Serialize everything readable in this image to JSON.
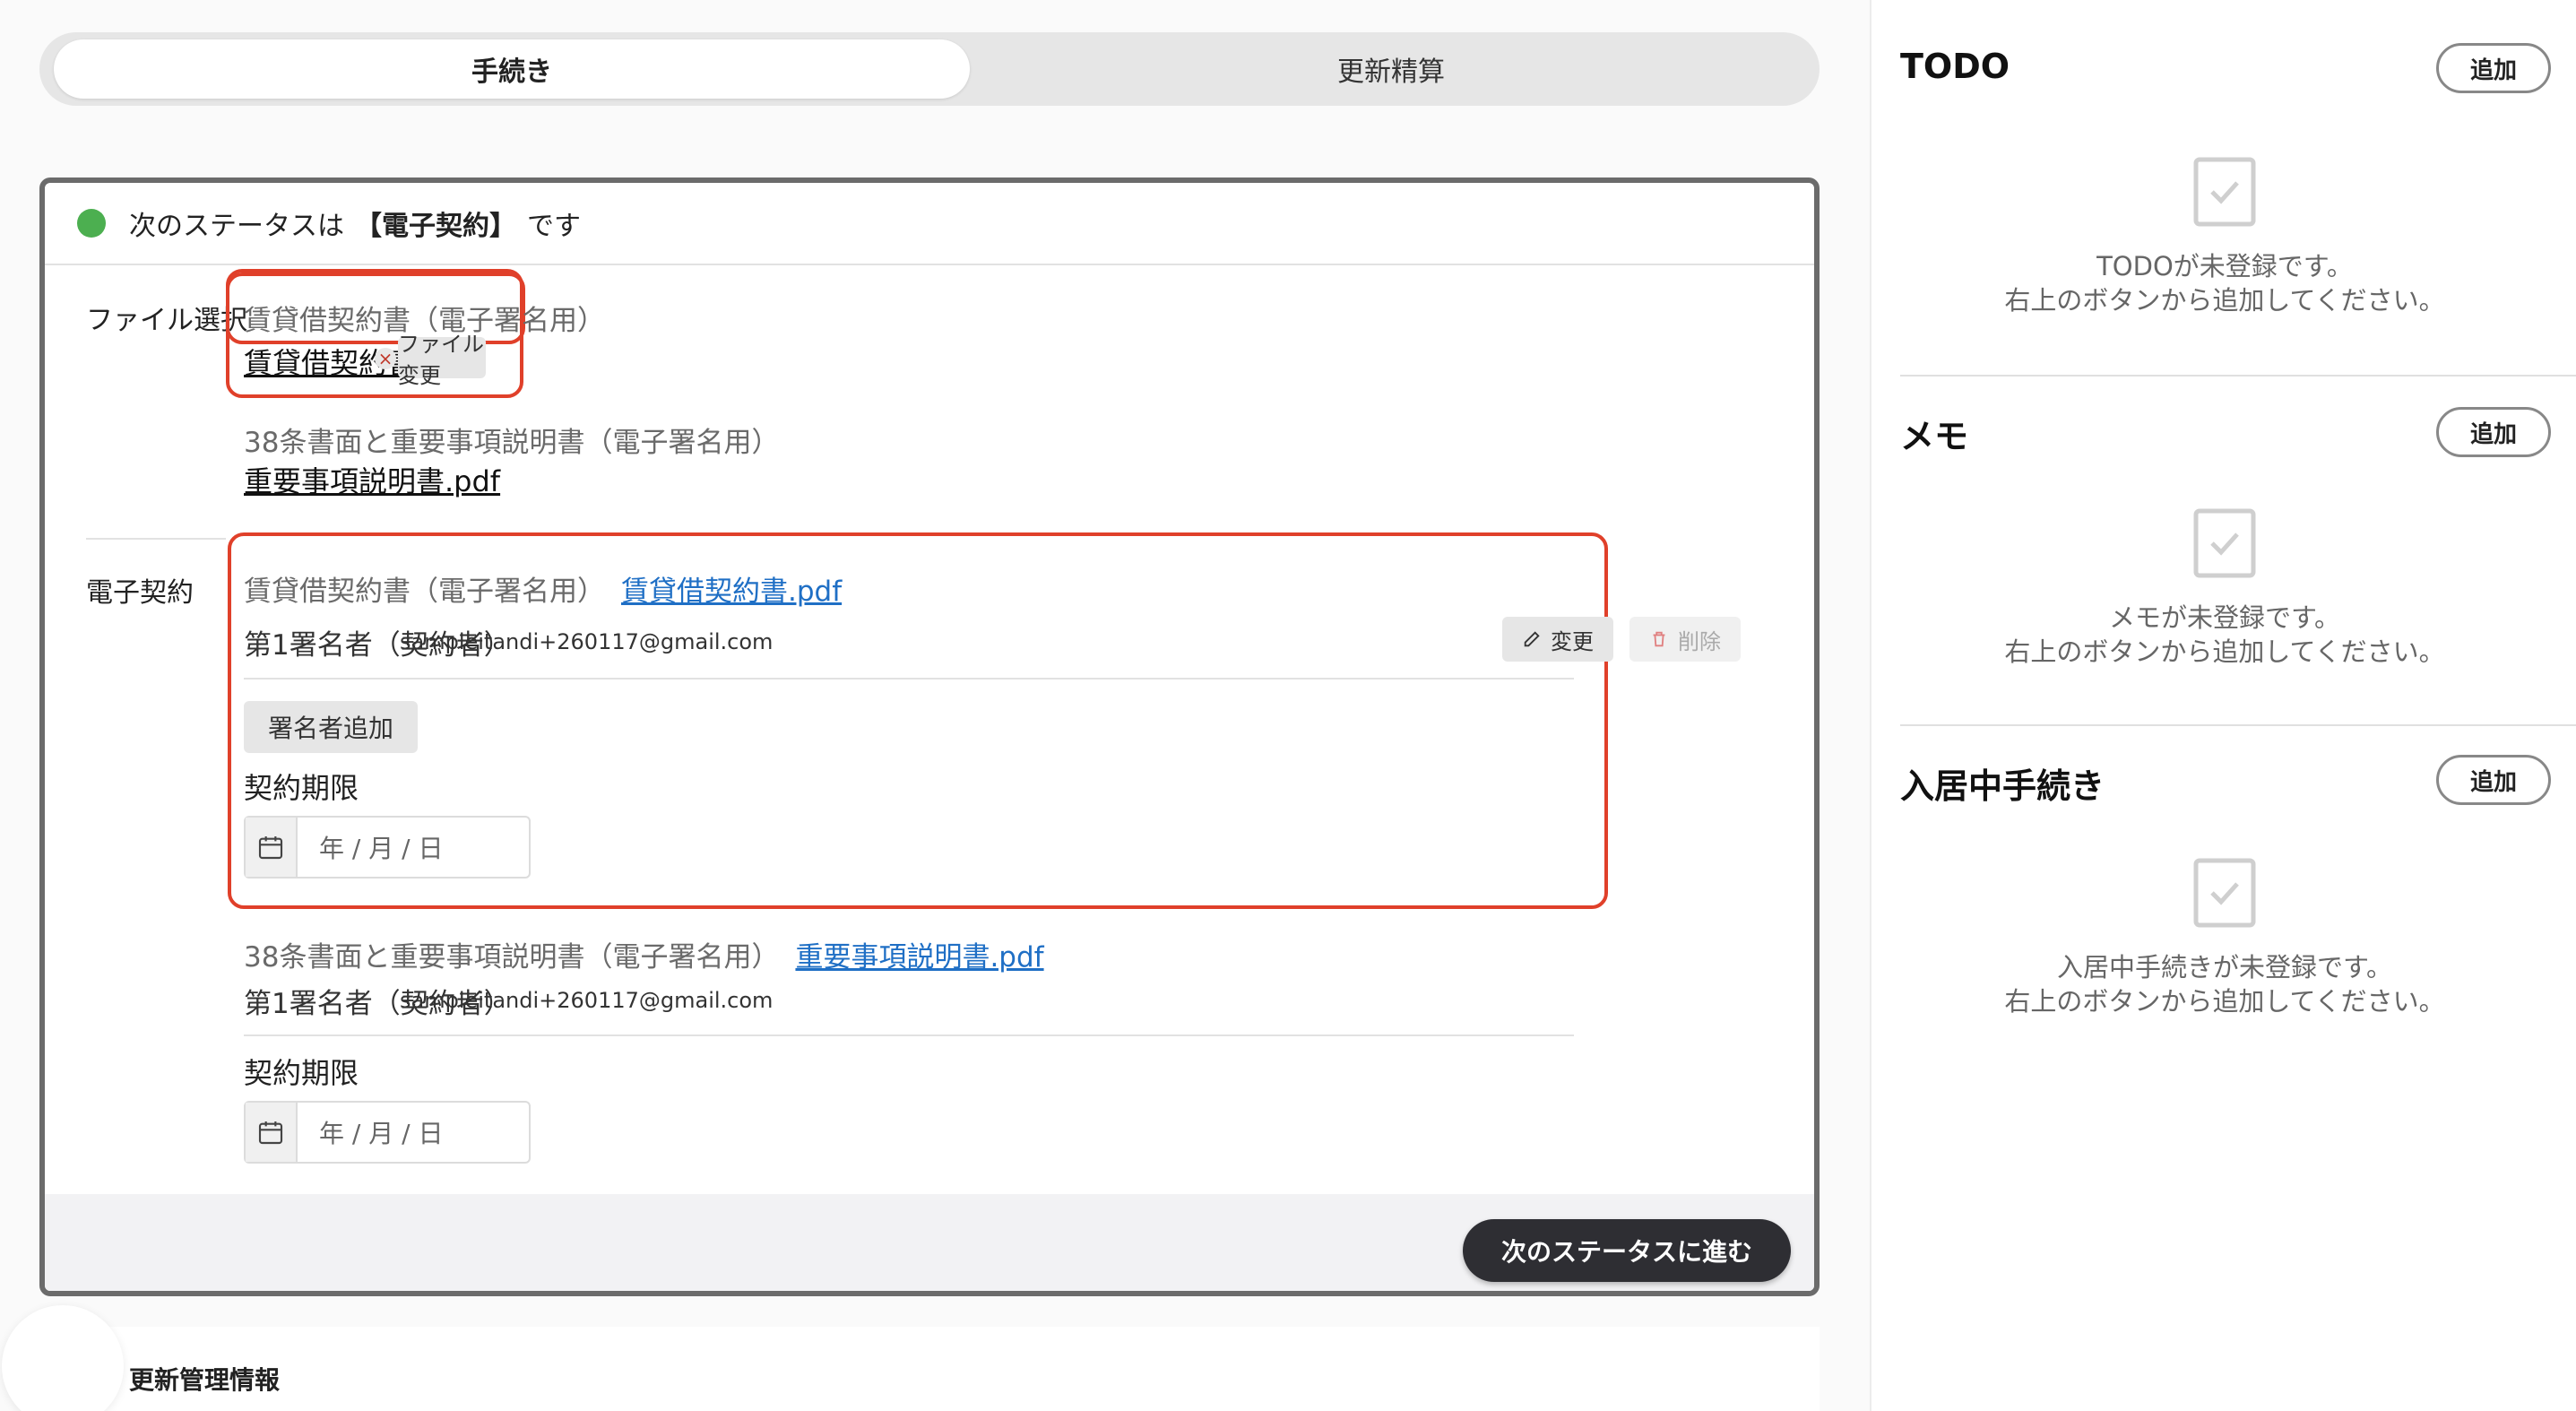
{
  "tabs": {
    "procedure": "手続き",
    "renewal": "更新精算"
  },
  "status": {
    "prefix": "次のステータスは",
    "name": "【電子契約】",
    "suffix": "です"
  },
  "file_select": {
    "label": "ファイル選択",
    "doc1": {
      "title": "賃貸借契約書（電子署名用）",
      "file": "賃貸借契約書.pdf",
      "remove": "×",
      "change_button": "ファイル変更"
    },
    "doc2": {
      "title": "38条書面と重要事項説明書（電子署名用）",
      "file": "重要事項説明書.pdf"
    }
  },
  "e_contract": {
    "label": "電子契約",
    "block1": {
      "title": "賃貸借契約書（電子署名用）",
      "file": "賃貸借契約書.pdf",
      "signer_label": "第1署名者（契約者）",
      "signer_email": "sampleitandi+260117@gmail.com",
      "edit_button": "変更",
      "delete_button": "削除",
      "add_signer_button": "署名者追加",
      "deadline_label": "契約期限",
      "date_placeholder": "年 / 月 / 日"
    },
    "block2": {
      "title": "38条書面と重要事項説明書（電子署名用）",
      "file": "重要事項説明書.pdf",
      "signer_label": "第1署名者（契約者）",
      "signer_email": "sampleitandi+260117@gmail.com",
      "deadline_label": "契約期限",
      "date_placeholder": "年 / 月 / 日"
    }
  },
  "next_button": "次のステータスに進む",
  "lower_section_title": "更新管理情報",
  "sidebar": {
    "todo": {
      "title": "TODO",
      "add": "追加",
      "empty_line1": "TODOが未登録です。",
      "empty_line2": "右上のボタンから追加してください。"
    },
    "memo": {
      "title": "メモ",
      "add": "追加",
      "empty_line1": "メモが未登録です。",
      "empty_line2": "右上のボタンから追加してください。"
    },
    "move_in": {
      "title": "入居中手続き",
      "add": "追加",
      "empty_line1": "入居中手続きが未登録です。",
      "empty_line2": "右上のボタンから追加してください。"
    }
  },
  "colors": {
    "status_dot": "#4caf50",
    "highlight_border": "#e0402a",
    "link_blue": "#1f6fc5",
    "primary_button": "#2e2e33"
  }
}
